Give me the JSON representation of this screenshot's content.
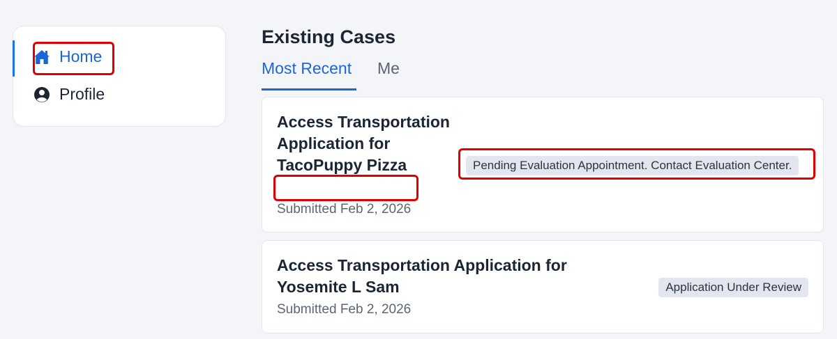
{
  "sidebar": {
    "items": [
      {
        "label": "Home",
        "icon": "home-icon",
        "active": true
      },
      {
        "label": "Profile",
        "icon": "user-circle-icon",
        "active": false
      }
    ]
  },
  "main": {
    "heading": "Existing Cases",
    "tabs": [
      {
        "label": "Most Recent",
        "active": true
      },
      {
        "label": "Me",
        "active": false
      }
    ],
    "cases": [
      {
        "title": "Access Transportation Application for TacoPuppy Pizza",
        "submitted": "Submitted Feb 2, 2026",
        "status": "Pending Evaluation Appointment. Contact Evaluation Center."
      },
      {
        "title": "Access Transportation Application for Yosemite L Sam",
        "submitted": "Submitted Feb 2, 2026",
        "status": "Application Under Review"
      }
    ]
  },
  "colors": {
    "accent": "#1a66d9",
    "highlight": "#e00000",
    "badge_bg": "#e3e6ef",
    "page_bg": "#f4f5f9"
  }
}
